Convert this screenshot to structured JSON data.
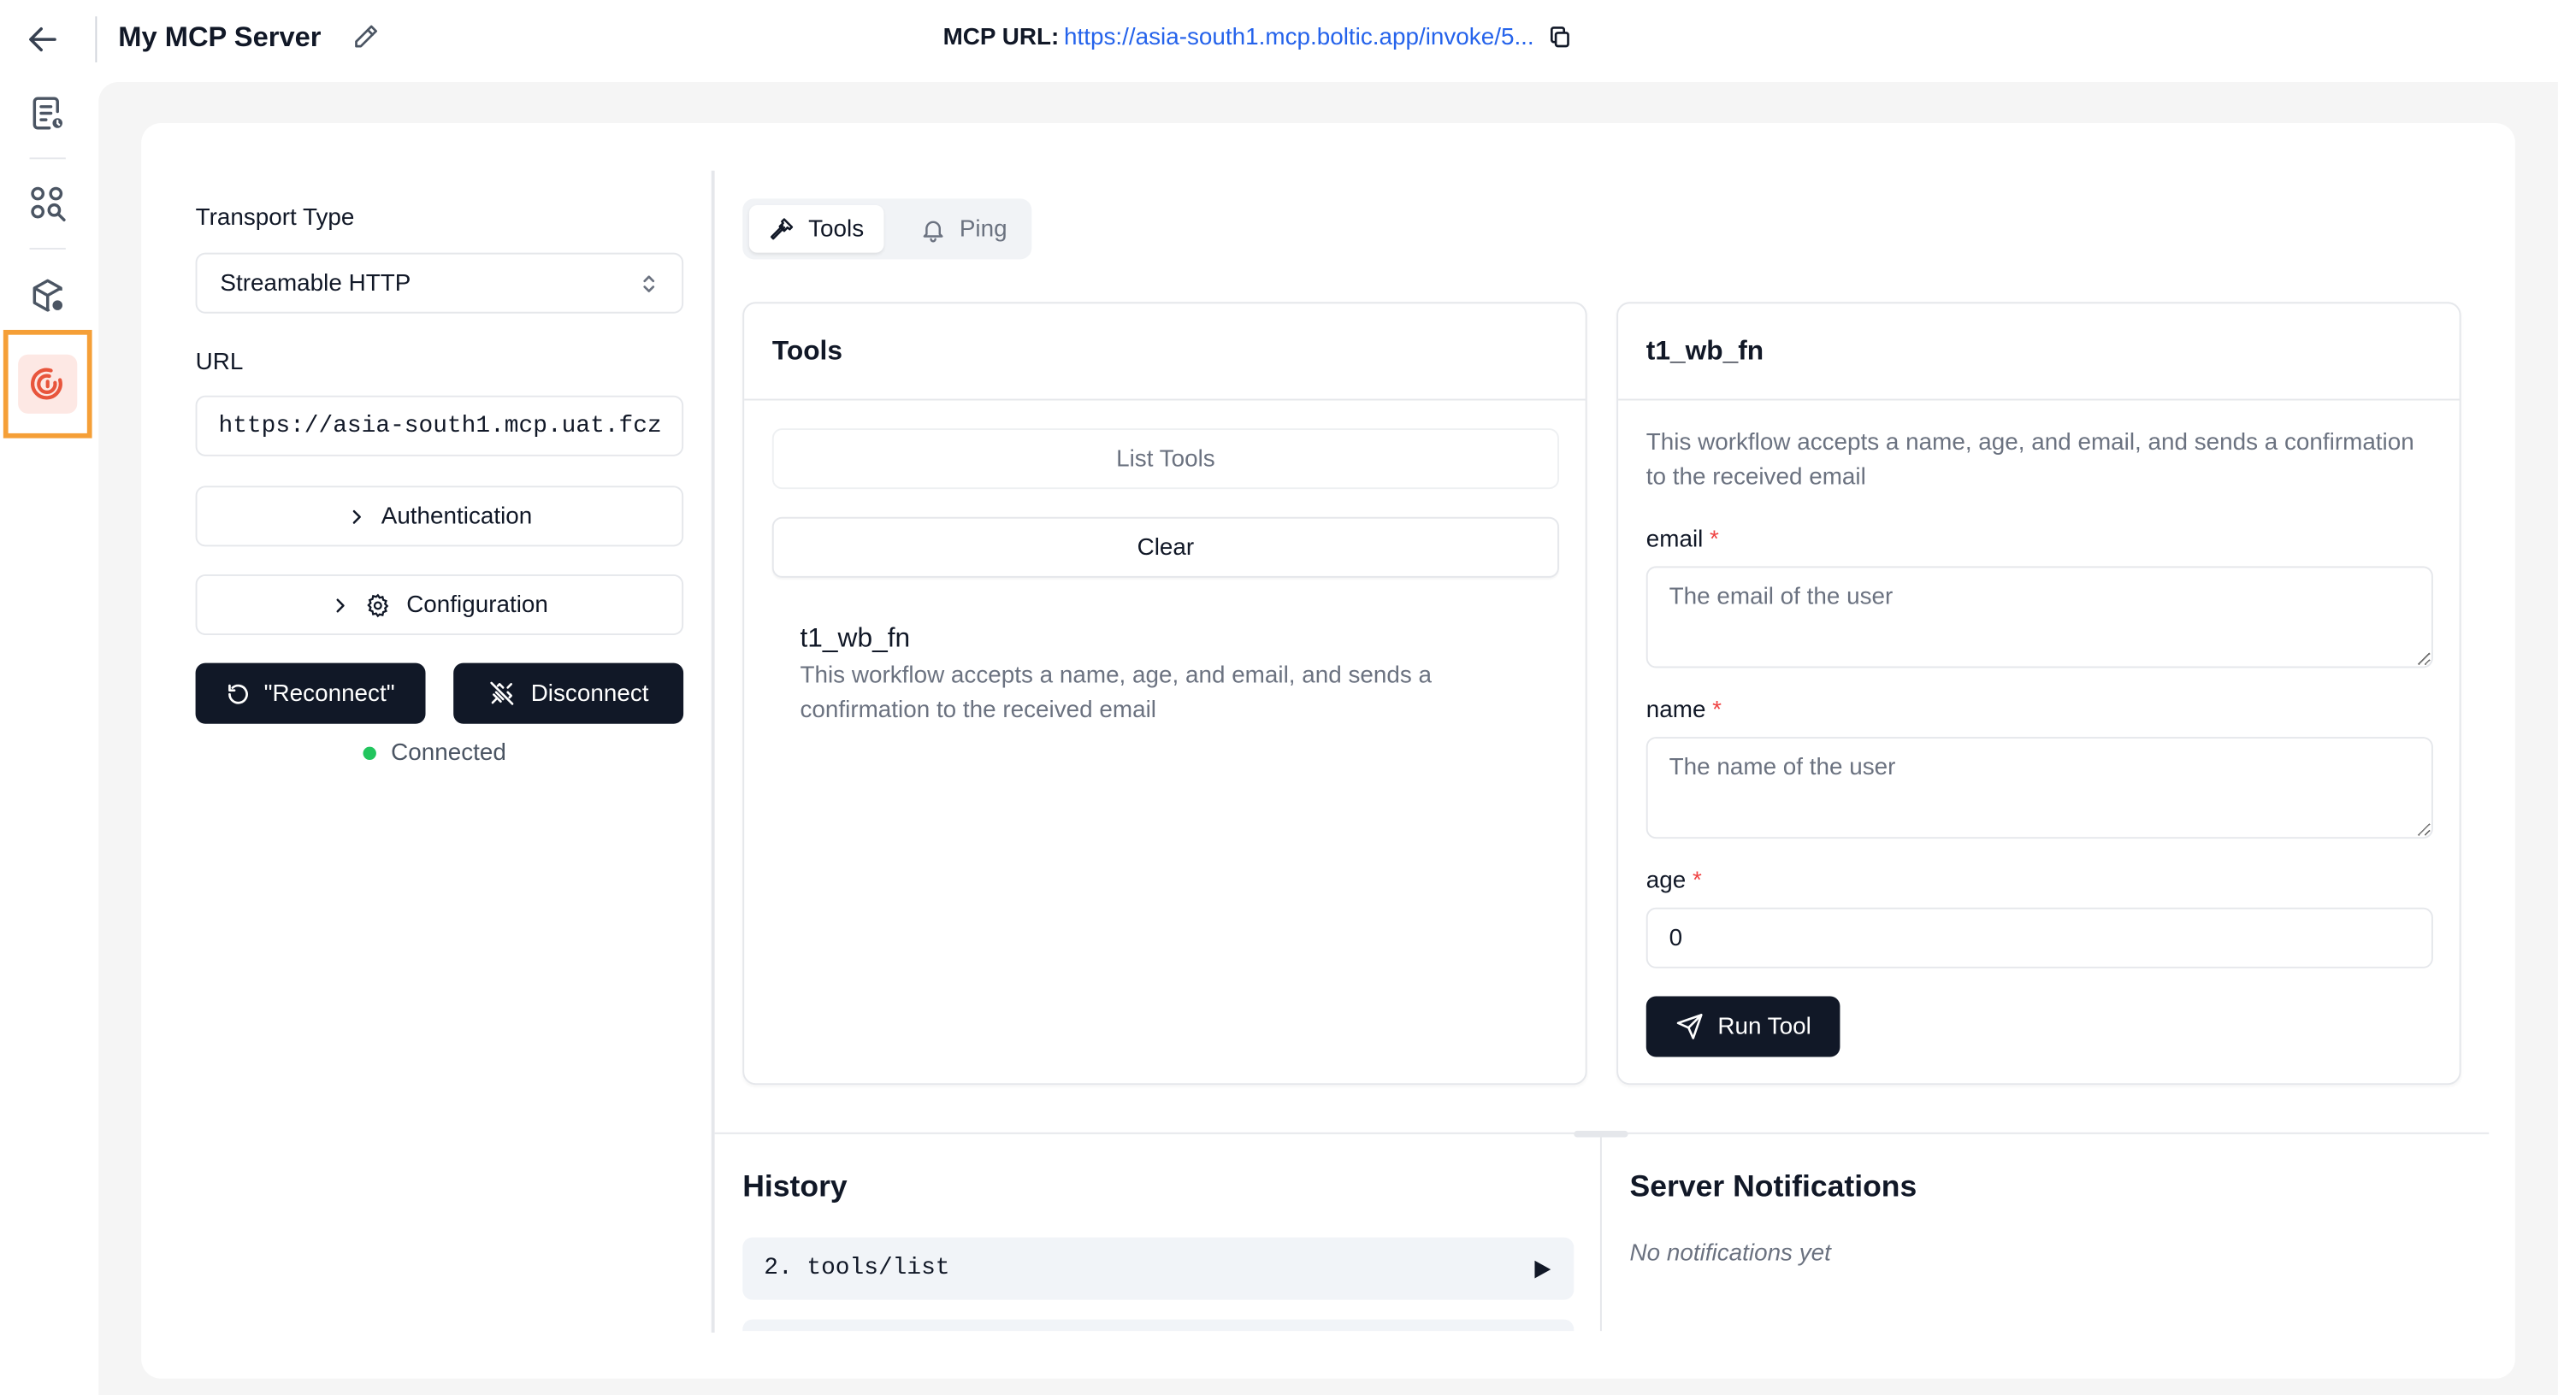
{
  "header": {
    "server_name": "My MCP Server",
    "mcp_url_label": "MCP URL:",
    "mcp_url": "https://asia-south1.mcp.boltic.app/invoke/5..."
  },
  "rail": {
    "icons": [
      "logs-icon",
      "explore-search-icon",
      "package-settings-icon",
      "mcp-inspector-icon"
    ],
    "active_index": 3,
    "active_color": "#e8553c",
    "highlight_color": "#f59f37"
  },
  "connection": {
    "transport_label": "Transport Type",
    "transport_value": "Streamable HTTP",
    "url_label": "URL",
    "url_value": "https://asia-south1.mcp.uat.fcz",
    "authentication_label": "Authentication",
    "configuration_label": "Configuration",
    "reconnect_label": "\"Reconnect\"",
    "disconnect_label": "Disconnect",
    "status_text": "Connected",
    "status_color": "#22c55e"
  },
  "tabs": [
    {
      "label": "Tools",
      "icon": "hammer-icon",
      "active": true
    },
    {
      "label": "Ping",
      "icon": "bell-icon",
      "active": false
    }
  ],
  "tools_panel": {
    "title": "Tools",
    "list_tools_label": "List Tools",
    "clear_label": "Clear",
    "items": [
      {
        "name": "t1_wb_fn",
        "description": "This workflow accepts a name, age, and email, and sends a confirmation to the received email"
      }
    ]
  },
  "tool_detail": {
    "title": "t1_wb_fn",
    "description": "This workflow accepts a name, age, and email, and sends a confirmation to the received email",
    "fields": [
      {
        "label": "email",
        "required": "*",
        "placeholder": "The email of the user",
        "value": ""
      },
      {
        "label": "name",
        "required": "*",
        "placeholder": "The name of the user",
        "value": ""
      },
      {
        "label": "age",
        "required": "*",
        "placeholder": "",
        "value": "0"
      }
    ],
    "run_label": "Run Tool"
  },
  "history": {
    "title": "History",
    "items": [
      {
        "text": "2. tools/list"
      }
    ]
  },
  "notifications": {
    "title": "Server Notifications",
    "empty_text": "No notifications yet"
  },
  "colors": {
    "dark_button": "#111827",
    "link": "#2563eb",
    "required": "#ef4444"
  }
}
